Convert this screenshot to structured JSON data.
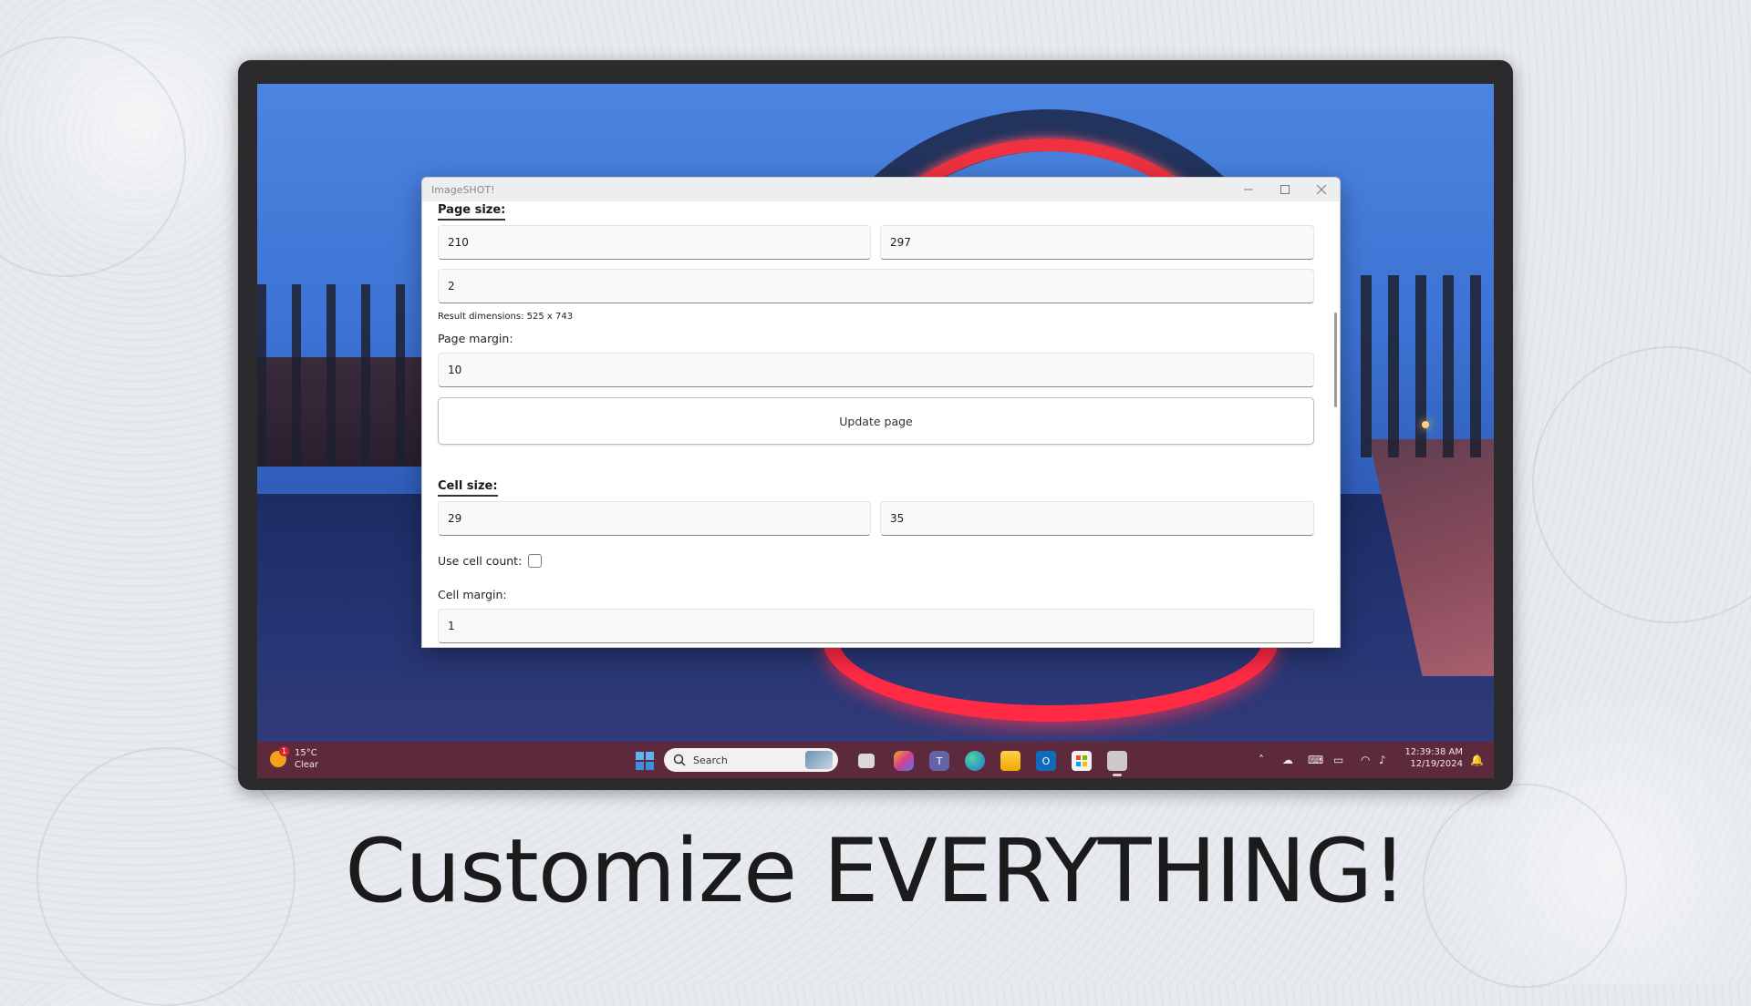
{
  "window": {
    "title": "ImageSHOT!",
    "minimize_icon": "minimize-icon",
    "maximize_icon": "maximize-icon",
    "close_icon": "close-icon"
  },
  "page_size": {
    "heading": "Page size:",
    "width": "210",
    "height": "297",
    "scale": "2",
    "result_dimensions": "Result dimensions: 525 x 743",
    "margin_label": "Page margin:",
    "margin": "10",
    "update_button": "Update page"
  },
  "cell_size": {
    "heading": "Cell size:",
    "width": "29",
    "height": "35",
    "use_cell_count_label": "Use cell count:",
    "use_cell_count_checked": false,
    "margin_label": "Cell margin:",
    "margin": "1"
  },
  "taskbar": {
    "weather_badge": "1",
    "temperature": "15°C",
    "condition": "Clear",
    "search_placeholder": "Search",
    "time": "12:39:38 AM",
    "date": "12/19/2024",
    "accent": "#5c2a3c"
  },
  "headline": "Customize EVERYTHING!"
}
